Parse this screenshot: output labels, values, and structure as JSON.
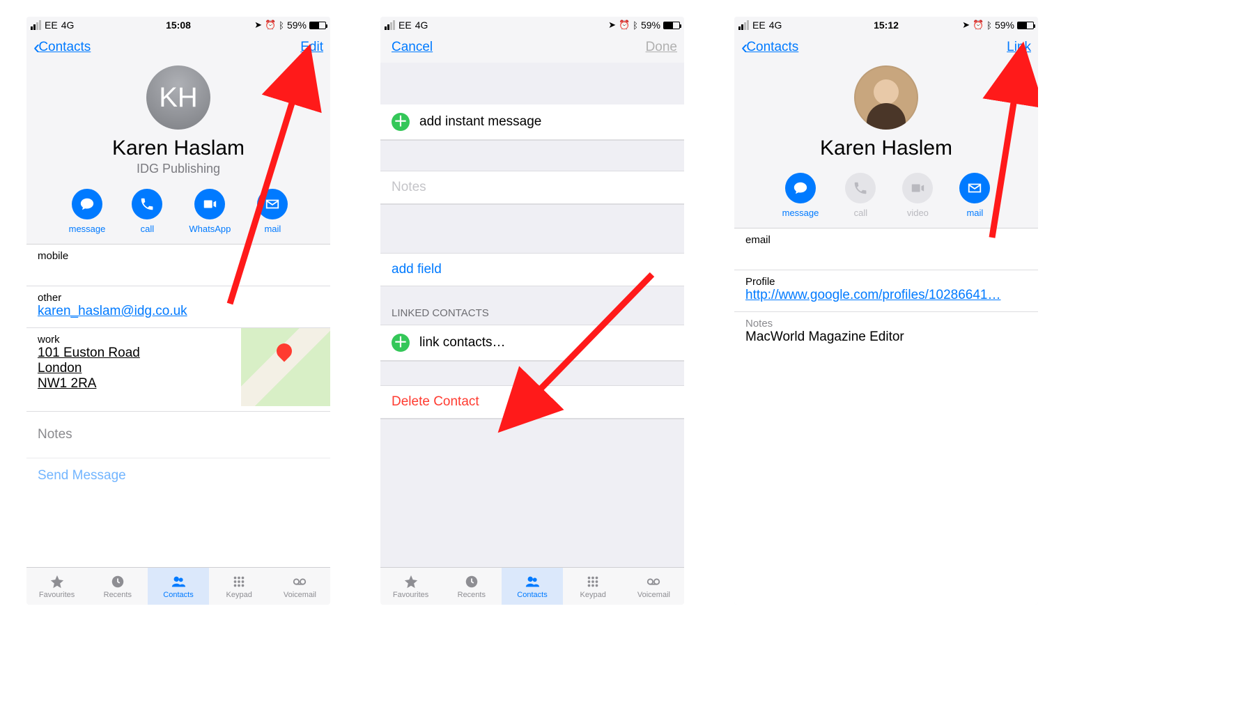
{
  "status": {
    "carrier": "EE",
    "network": "4G",
    "time_a": "15:08",
    "time_c": "15:12",
    "battery_pct": "59%",
    "loc_icon": "location-icon",
    "alarm_icon": "alarm-icon",
    "bt_icon": "bluetooth-icon"
  },
  "screen_a": {
    "back_label": "Contacts",
    "right_button": "Edit",
    "avatar_initials": "KH",
    "name": "Karen Haslam",
    "org": "IDG Publishing",
    "actions": [
      {
        "key": "message",
        "label": "message",
        "enabled": true
      },
      {
        "key": "call",
        "label": "call",
        "enabled": true
      },
      {
        "key": "whatsapp",
        "label": "WhatsApp",
        "enabled": true
      },
      {
        "key": "mail",
        "label": "mail",
        "enabled": true
      }
    ],
    "fields": {
      "mobile_label": "mobile",
      "other_label": "other",
      "other_value": "karen_haslam@idg.co.uk",
      "work_label": "work",
      "address_line1": "101 Euston Road",
      "address_line2": "London",
      "address_line3": "NW1 2RA",
      "notes_label": "Notes",
      "send_message": "Send Message"
    }
  },
  "screen_b": {
    "left_button": "Cancel",
    "right_button": "Done",
    "add_im": "add instant message",
    "notes_placeholder": "Notes",
    "add_field": "add field",
    "linked_header": "LINKED CONTACTS",
    "link_contacts": "link contacts…",
    "delete_contact": "Delete Contact"
  },
  "screen_c": {
    "back_label": "Contacts",
    "right_button": "Link",
    "name": "Karen Haslem",
    "actions": [
      {
        "key": "message",
        "label": "message",
        "enabled": true
      },
      {
        "key": "call",
        "label": "call",
        "enabled": false
      },
      {
        "key": "video",
        "label": "video",
        "enabled": false
      },
      {
        "key": "mail",
        "label": "mail",
        "enabled": true
      }
    ],
    "email_label": "email",
    "profile_label": "Profile",
    "profile_url": "http://www.google.com/profiles/10286641…",
    "notes_label": "Notes",
    "notes_value": "MacWorld Magazine Editor"
  },
  "tabs": [
    {
      "key": "favourites",
      "label": "Favourites"
    },
    {
      "key": "recents",
      "label": "Recents"
    },
    {
      "key": "contacts",
      "label": "Contacts",
      "active": true
    },
    {
      "key": "keypad",
      "label": "Keypad"
    },
    {
      "key": "voicemail",
      "label": "Voicemail"
    }
  ]
}
